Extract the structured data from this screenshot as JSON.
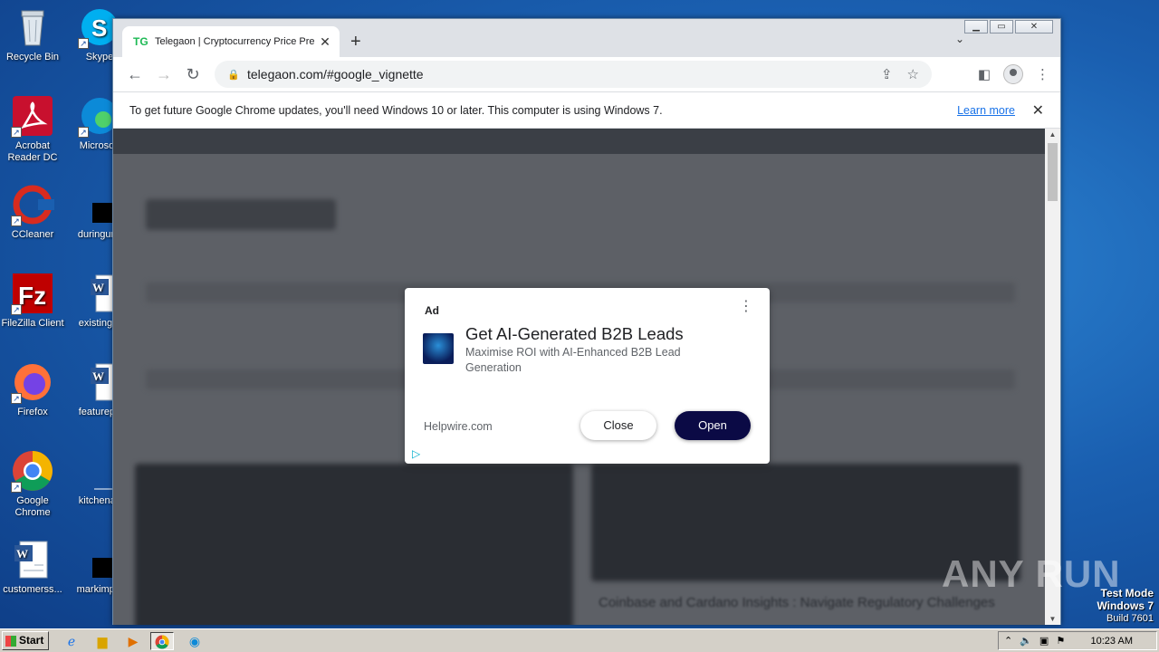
{
  "desktop": {
    "icons_col1": [
      "Recycle Bin",
      "Acrobat Reader DC",
      "CCleaner",
      "FileZilla Client",
      "Firefox",
      "Google Chrome",
      "customerss..."
    ],
    "icons_col2": [
      "Skype",
      "Microsoft",
      "duringunc",
      "existingm",
      "featurepa",
      "kitchenas",
      "markimple"
    ]
  },
  "browser": {
    "tab_favicon": "TG",
    "tab_title": "Telegaon | Cryptocurrency Price Pre",
    "url": "telegaon.com/#google_vignette",
    "infobar_text": "To get future Google Chrome updates, you'll need Windows 10 or later. This computer is using Windows 7.",
    "infobar_link": "Learn more"
  },
  "ad": {
    "label": "Ad",
    "headline": "Get AI-Generated B2B Leads",
    "description": "Maximise ROI with AI-Enhanced B2B Lead Generation",
    "domain": "Helpwire.com",
    "close_label": "Close",
    "open_label": "Open"
  },
  "page_bottom_text": "Coinbase and Cardano Insights : Navigate Regulatory Challenges",
  "watermark": {
    "brand": "ANY RUN",
    "test_mode": "Test Mode",
    "os": "Windows 7",
    "build": "Build 7601"
  },
  "taskbar": {
    "start_label": "Start",
    "clock": "10:23 AM"
  },
  "colors": {
    "ad_open_button": "#0b0a45",
    "link": "#1a73e8",
    "favicon": "#1db954"
  }
}
